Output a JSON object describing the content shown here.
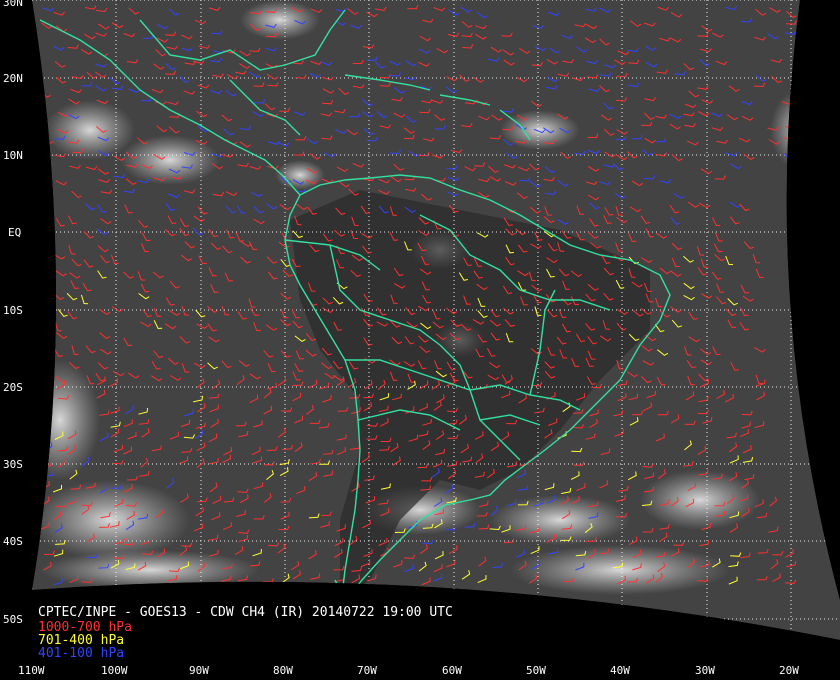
{
  "title": "CPTEC/INPE - GOES13 - CDW CH4 (IR) 20140722 19:00 UTC",
  "legend": [
    {
      "label": "1000-700 hPa",
      "color": "#ff3030"
    },
    {
      "label": "701-400 hPa",
      "color": "#ffff33"
    },
    {
      "label": "401-100 hPa",
      "color": "#3344ff"
    }
  ],
  "lat_labels": [
    "30N",
    "20N",
    "10N",
    "EQ",
    "10S",
    "20S",
    "30S",
    "40S",
    "50S"
  ],
  "lon_labels": [
    "110W",
    "100W",
    "90W",
    "80W",
    "70W",
    "60W",
    "50W",
    "40W",
    "30W",
    "20W"
  ],
  "colors": {
    "background": "#000000",
    "coastline": "#33e0a0",
    "grid": "#ffffff",
    "label": "#ffffff"
  }
}
